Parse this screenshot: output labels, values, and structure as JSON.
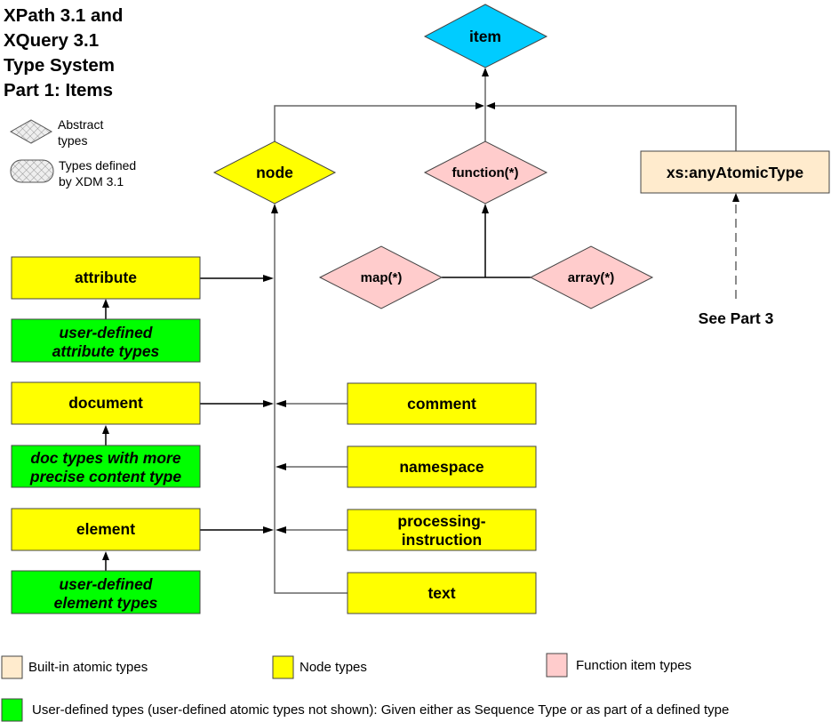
{
  "title": {
    "lines": [
      "XPath 3.1 and",
      "XQuery 3.1",
      "Type System",
      "Part 1: Items"
    ]
  },
  "shape_legend": {
    "abstract": [
      "Abstract",
      "types"
    ],
    "xdm": [
      "Types defined",
      "by XDM 3.1"
    ]
  },
  "colors": {
    "item": "#00CCFF",
    "node": "#FFFF00",
    "function": "#FFCCCC",
    "atomic": "#FFEBCD",
    "user_defined": "#00FF00"
  },
  "nodes": {
    "item": "item",
    "node": "node",
    "function": "function(*)",
    "map": "map(*)",
    "array": "array(*)",
    "any_atomic": "xs:anyAtomicType",
    "see_part3": "See Part 3",
    "attribute": "attribute",
    "user_attribute": [
      "user-defined",
      "attribute types"
    ],
    "document": "document",
    "doc_types": [
      "doc types with more",
      "precise content type"
    ],
    "element": "element",
    "user_element": [
      "user-defined",
      "element types"
    ],
    "comment": "comment",
    "namespace": "namespace",
    "processing_instruction": [
      "processing-",
      "instruction"
    ],
    "text": "text"
  },
  "legend": {
    "builtin_atomic": "Built-in atomic types",
    "node_types": "Node types",
    "function_item_types": "Function item types",
    "user_defined": "User-defined types (user-defined atomic types not shown):  Given either as Sequence Type or as part of a defined type"
  }
}
